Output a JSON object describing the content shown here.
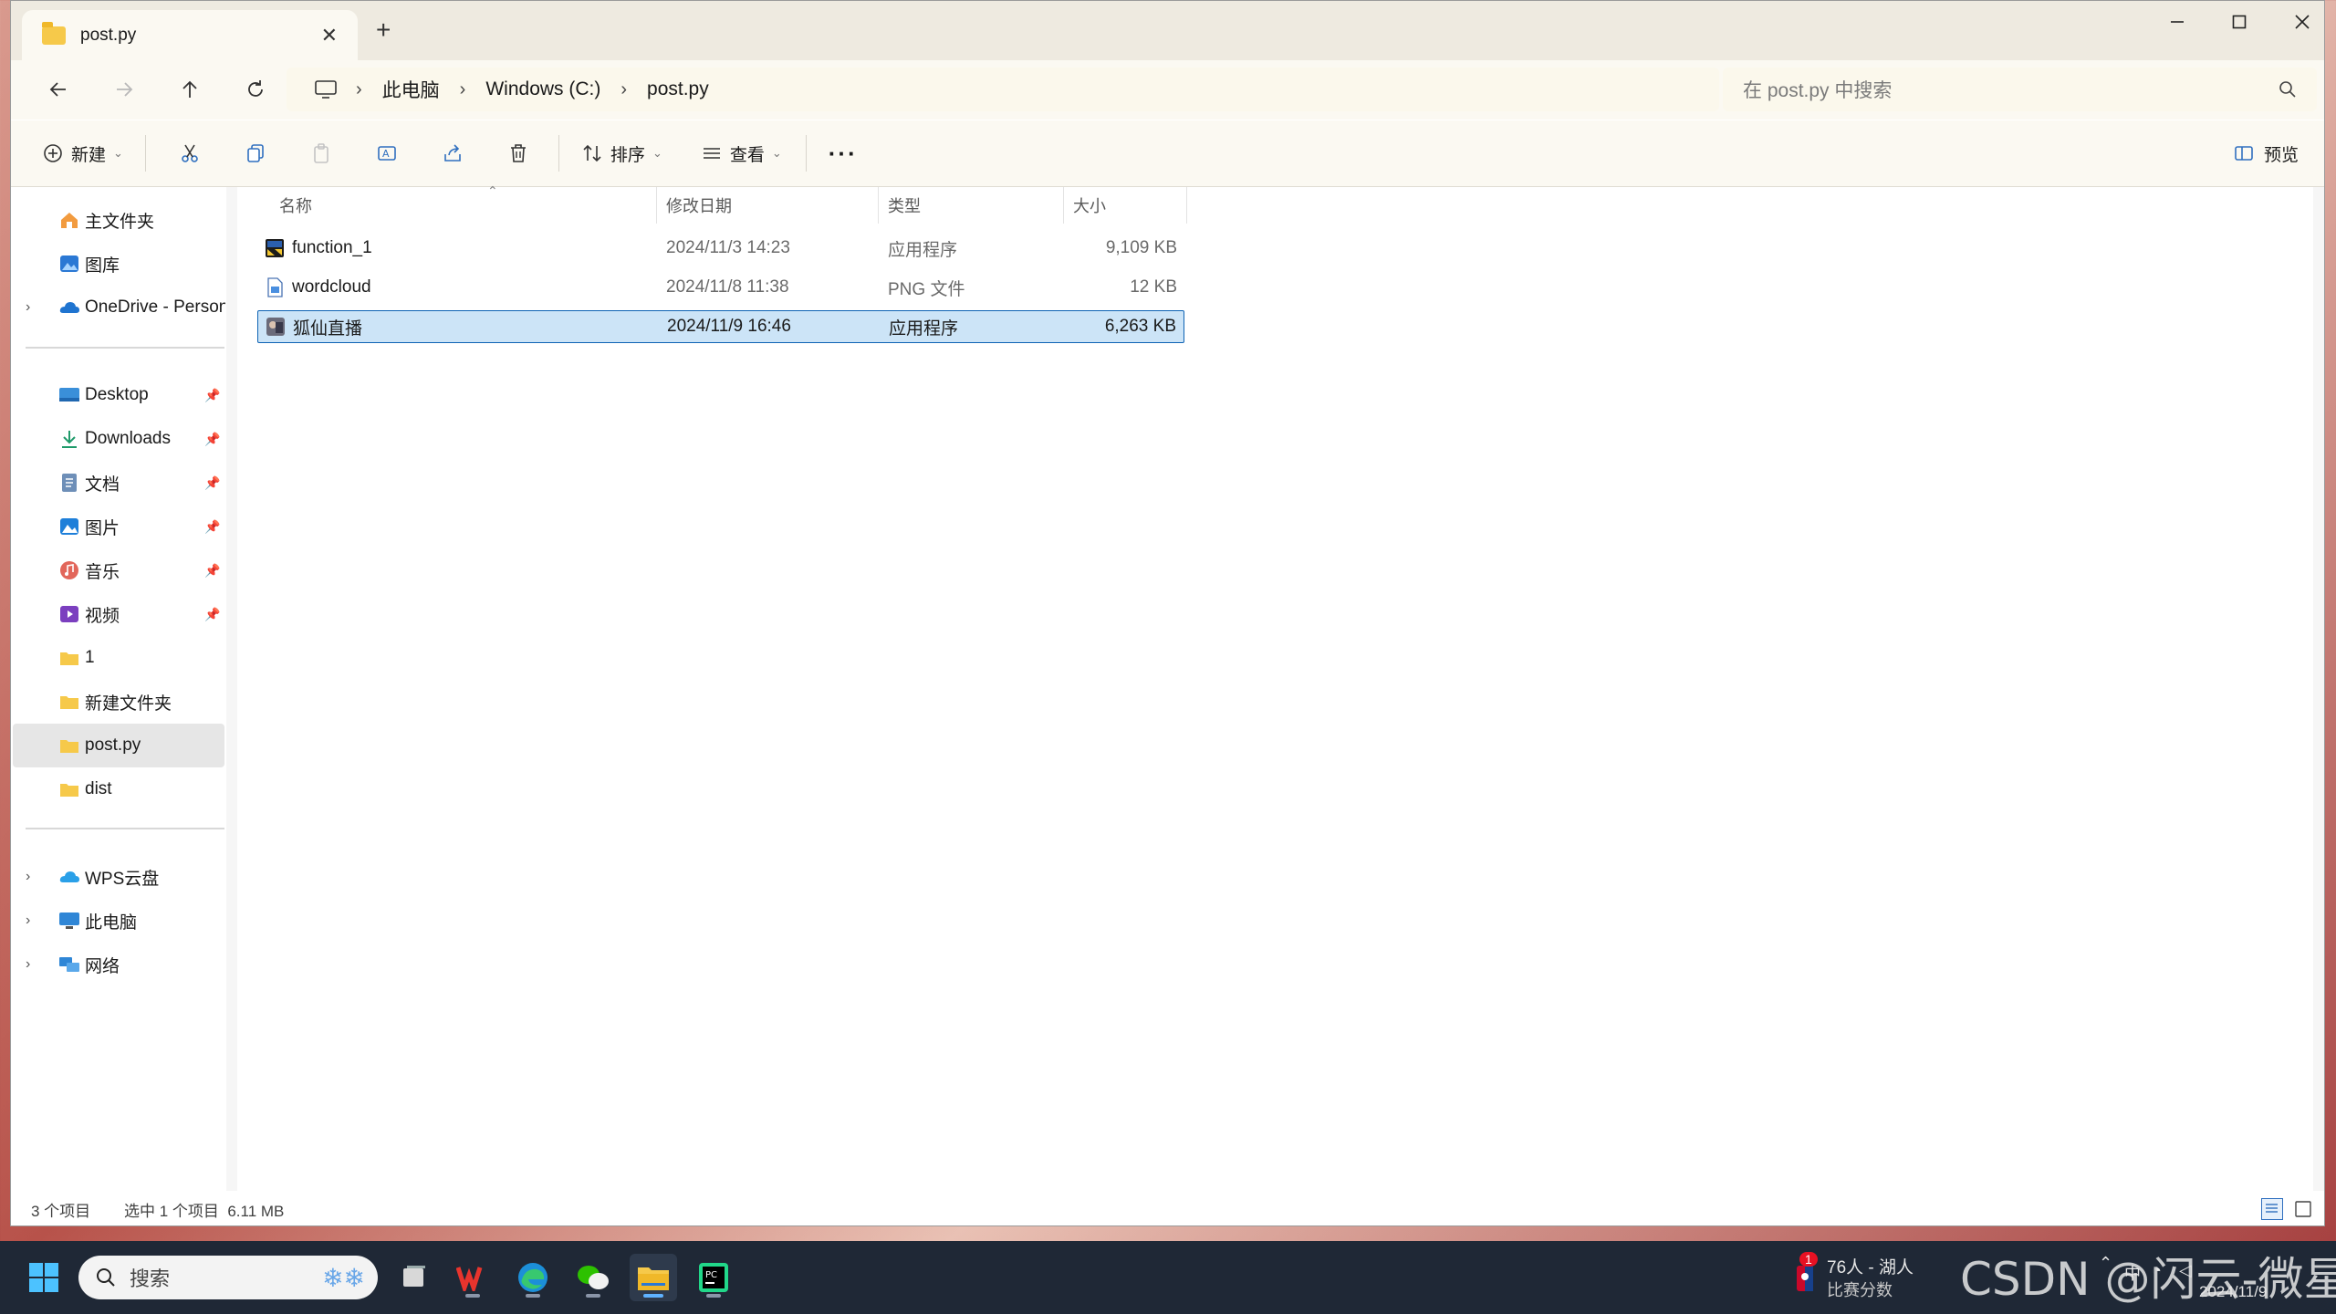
{
  "window": {
    "tab_title": "post.py",
    "new_tab_symbol": "+",
    "close_symbol": "✕"
  },
  "address": {
    "breadcrumb": [
      "此电脑",
      "Windows (C:)",
      "post.py"
    ],
    "search_placeholder": "在 post.py 中搜索"
  },
  "toolbar": {
    "new_label": "新建",
    "sort_label": "排序",
    "view_label": "查看",
    "more_label": "···",
    "preview_label": "预览"
  },
  "sidebar": {
    "quick": [
      {
        "label": "主文件夹",
        "icon": "home-icon"
      },
      {
        "label": "图库",
        "icon": "gallery-icon"
      },
      {
        "label": "OneDrive - Personal",
        "icon": "onedrive-icon",
        "expandable": true
      }
    ],
    "pinned": [
      {
        "label": "Desktop",
        "icon": "desktop-icon",
        "pinned": true
      },
      {
        "label": "Downloads",
        "icon": "downloads-icon",
        "pinned": true
      },
      {
        "label": "文档",
        "icon": "documents-icon",
        "pinned": true
      },
      {
        "label": "图片",
        "icon": "pictures-icon",
        "pinned": true
      },
      {
        "label": "音乐",
        "icon": "music-icon",
        "pinned": true
      },
      {
        "label": "视频",
        "icon": "videos-icon",
        "pinned": true
      },
      {
        "label": "1",
        "icon": "folder-icon"
      },
      {
        "label": "新建文件夹",
        "icon": "folder-icon"
      },
      {
        "label": "post.py",
        "icon": "folder-icon",
        "selected": true
      },
      {
        "label": "dist",
        "icon": "folder-icon"
      }
    ],
    "locations": [
      {
        "label": "WPS云盘",
        "icon": "wps-cloud-icon"
      },
      {
        "label": "此电脑",
        "icon": "this-pc-icon"
      },
      {
        "label": "网络",
        "icon": "network-icon"
      }
    ]
  },
  "columns": {
    "name": "名称",
    "modified": "修改日期",
    "type": "类型",
    "size": "大小"
  },
  "files": [
    {
      "name": "function_1",
      "modified": "2024/11/3 14:23",
      "type": "应用程序",
      "size": "9,109 KB",
      "icon": "exe-icon"
    },
    {
      "name": "wordcloud",
      "modified": "2024/11/8 11:38",
      "type": "PNG 文件",
      "size": "12 KB",
      "icon": "png-file-icon"
    },
    {
      "name": "狐仙直播",
      "modified": "2024/11/9 16:46",
      "type": "应用程序",
      "size": "6,263 KB",
      "icon": "app-icon",
      "selected": true
    }
  ],
  "status": {
    "count": "3 个项目",
    "selection": "选中 1 个项目  6.11 MB"
  },
  "taskbar": {
    "search_label": "搜索",
    "badge_count": "1",
    "news_line1": "76人 - 湖人",
    "news_line2": "比赛分数",
    "date_partial": "2024/11/9"
  },
  "watermark": "CSDN @闪云-微星",
  "colors": {
    "selection_bg": "#cce4f7",
    "selection_border": "#0e63b4",
    "folder": "#f6c94a",
    "taskbar": "#1f2836"
  }
}
